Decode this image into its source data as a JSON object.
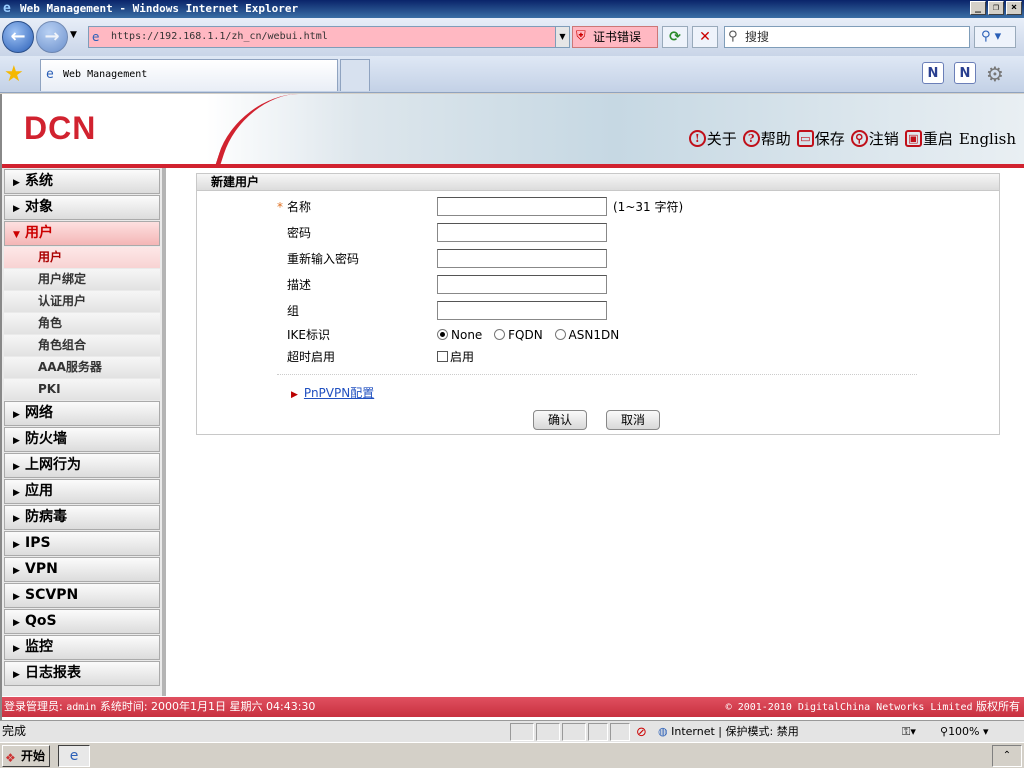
{
  "window": {
    "title": "Web Management - Windows Internet Explorer"
  },
  "browser": {
    "url": "https://192.168.1.1/zh_cn/webui.html",
    "cert_error": "证书错误",
    "search_placeholder": "搜搜",
    "tab_title": "Web Management"
  },
  "header": {
    "logo": "DCN",
    "links": [
      {
        "label": "关于",
        "icon": "!"
      },
      {
        "label": "帮助",
        "icon": "?"
      },
      {
        "label": "保存",
        "icon": "▭"
      },
      {
        "label": "注销",
        "icon": "⚲"
      },
      {
        "label": "重启",
        "icon": "▣"
      },
      {
        "label": "English",
        "icon": ""
      }
    ]
  },
  "sidebar": {
    "cat_system": "系统",
    "cat_object": "对象",
    "cat_user": "用户",
    "sub_user": "用户",
    "sub_binding": "用户绑定",
    "sub_auth": "认证用户",
    "sub_role": "角色",
    "sub_rolegroup": "角色组合",
    "sub_aaa": "AAA服务器",
    "sub_pki": "PKI",
    "cat_network": "网络",
    "cat_firewall": "防火墙",
    "cat_online": "上网行为",
    "cat_app": "应用",
    "cat_antivirus": "防病毒",
    "cat_ips": "IPS",
    "cat_vpn": "VPN",
    "cat_scvpn": "SCVPN",
    "cat_qos": "QoS",
    "cat_monitor": "监控",
    "cat_log": "日志报表"
  },
  "form": {
    "title": "新建用户",
    "required_mark": "*",
    "name_label": "名称",
    "name_hint": "(1~31 字符)",
    "password_label": "密码",
    "password2_label": "重新输入密码",
    "desc_label": "描述",
    "group_label": "组",
    "ike_label": "IKE标识",
    "ike_options": {
      "none": "None",
      "fqdn": "FQDN",
      "asn1dn": "ASN1DN"
    },
    "ike_selected": "None",
    "timeout_label": "超时启用",
    "timeout_checkbox": "启用",
    "pnpvpn_link": "PnPVPN配置",
    "ok_button": "确认",
    "cancel_button": "取消"
  },
  "footer": {
    "login_label": "登录管理员:",
    "login_user": "admin",
    "time_label": "系统时间:",
    "time_value": "2000年1月1日 星期六 04:43:30",
    "copyright": "© 2001-2010 DigitalChina Networks Limited",
    "rights": "版权所有"
  },
  "statusbar": {
    "text": "完成",
    "zone": "Internet | 保护模式: 禁用",
    "zoom": "100%"
  },
  "taskbar": {
    "start": "开始"
  }
}
